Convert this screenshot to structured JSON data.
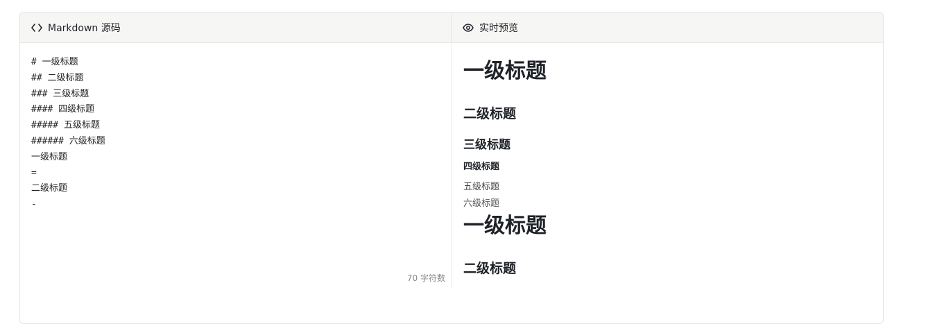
{
  "source_pane": {
    "title": "Markdown 源码",
    "icon": "code-icon",
    "lines": [
      "# 一级标题",
      "## 二级标题",
      "### 三级标题",
      "#### 四级标题",
      "##### 五级标题",
      "###### 六级标题",
      "一级标题",
      "=",
      "二级标题",
      "-"
    ],
    "char_count": "70 字符数"
  },
  "preview_pane": {
    "title": "实时预览",
    "icon": "eye-icon",
    "headings": {
      "h1_a": "一级标题",
      "h2_a": "二级标题",
      "h3": "三级标题",
      "h4": "四级标题",
      "h5": "五级标题",
      "h6": "六级标题",
      "h1_b": "一级标题",
      "h2_b": "二级标题"
    }
  }
}
